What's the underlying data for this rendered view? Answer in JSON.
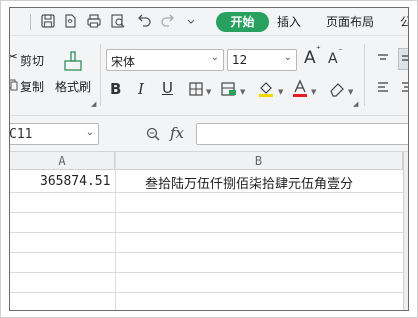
{
  "menubar": {
    "tabs": [
      {
        "label": "开始",
        "active": true
      },
      {
        "label": "插入",
        "active": false
      },
      {
        "label": "页面布局",
        "active": false
      },
      {
        "label": "公",
        "active": false
      }
    ],
    "accent_color": "#27a060"
  },
  "ribbon": {
    "cut_label": "剪切",
    "copy_label": "复制",
    "format_painter_label": "格式刷",
    "font_name": "宋体",
    "font_size": "12",
    "increase_font_glyph": "A",
    "decrease_font_glyph": "A",
    "bold_glyph": "B",
    "italic_glyph": "I",
    "underline_glyph": "U"
  },
  "formula_bar": {
    "name_box": "C11",
    "fx_label": "fx",
    "formula_value": ""
  },
  "sheet": {
    "columns": [
      "A",
      "B"
    ],
    "rows": [
      {
        "a": "365874.51",
        "b": "叁拾陆万伍仟捌佰柒拾肆元伍角壹分"
      }
    ]
  }
}
